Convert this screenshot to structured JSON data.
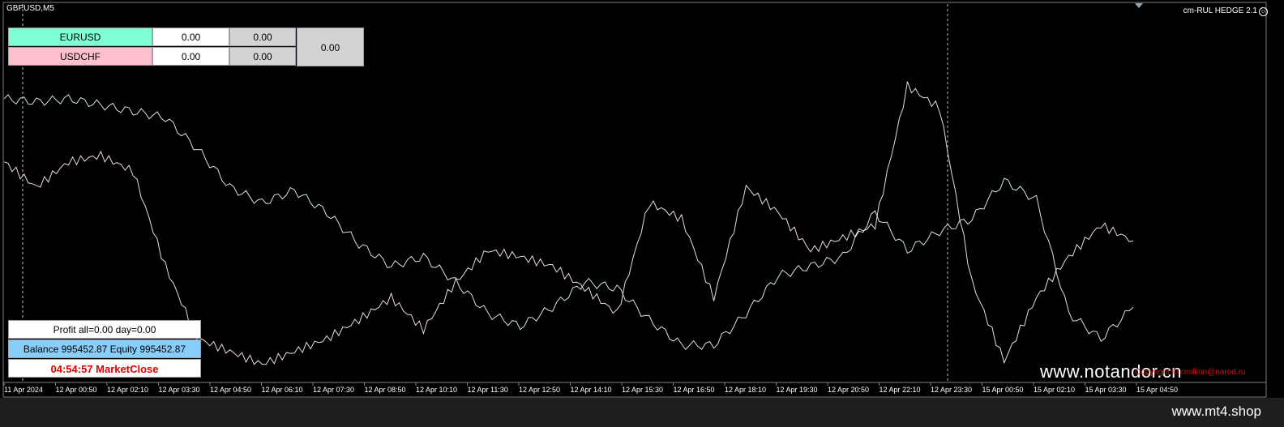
{
  "window": {
    "symbol": "GBPUSD,M5",
    "indicator_name": "cm-RUL HEDGE 2.1",
    "indicator_smile": "☺"
  },
  "hedge_panel": {
    "pairs": [
      {
        "name": "EURUSD",
        "value": "0.00",
        "profit": "0.00",
        "color": "#7fffd4"
      },
      {
        "name": "USDCHF",
        "value": "0.00",
        "profit": "0.00",
        "color": "#ffc0cb"
      }
    ],
    "total": "0.00"
  },
  "info_panel": {
    "profit": "Profit all=0.00    day=0.00",
    "balance": "Balance 995452.87    Equity 995452.87",
    "timer": "04:54:57 MarketClose"
  },
  "watermark": "www.notandor.cn",
  "copyright": "Copyright © cmillion@narod.ru",
  "site": "www.mt4.shop",
  "time_axis": [
    "11 Apr 2024",
    "12 Apr 00:50",
    "12 Apr 02:10",
    "12 Apr 03:30",
    "12 Apr 04:50",
    "12 Apr 06:10",
    "12 Apr 07:30",
    "12 Apr 08:50",
    "12 Apr 10:10",
    "12 Apr 11:30",
    "12 Apr 12:50",
    "12 Apr 14:10",
    "12 Apr 15:30",
    "12 Apr 16:50",
    "12 Apr 18:10",
    "12 Apr 19:30",
    "12 Apr 20:50",
    "12 Apr 22:10",
    "12 Apr 23:30",
    "15 Apr 00:50",
    "15 Apr 02:10",
    "15 Apr 03:30",
    "15 Apr 04:50"
  ],
  "chart_data": {
    "type": "line",
    "series": [
      {
        "name": "EURUSD",
        "color": "#7fffd4",
        "values": [
          88,
          87,
          88,
          86,
          84,
          82,
          72,
          60,
          55,
          59,
          52,
          42,
          35,
          38,
          30,
          20,
          16,
          22,
          30,
          28,
          18,
          10,
          10,
          20,
          32,
          35,
          38,
          52,
          40,
          46,
          50,
          62,
          56,
          20,
          12,
          22
        ]
      },
      {
        "name": "USDCHF",
        "color": "#ffc0cb",
        "values": [
          68,
          60,
          68,
          70,
          65,
          35,
          12,
          8,
          4,
          8,
          12,
          18,
          25,
          15,
          30,
          40,
          38,
          35,
          28,
          20,
          55,
          50,
          25,
          60,
          52,
          40,
          44,
          48,
          92,
          85,
          30,
          5,
          25,
          38,
          48,
          43
        ]
      }
    ]
  },
  "colors": {
    "background": "#000000",
    "eurusd": "#7fffd4",
    "usdchf": "#ffc0cb",
    "timer": "#e00000",
    "balance_row": "#87cefa"
  }
}
